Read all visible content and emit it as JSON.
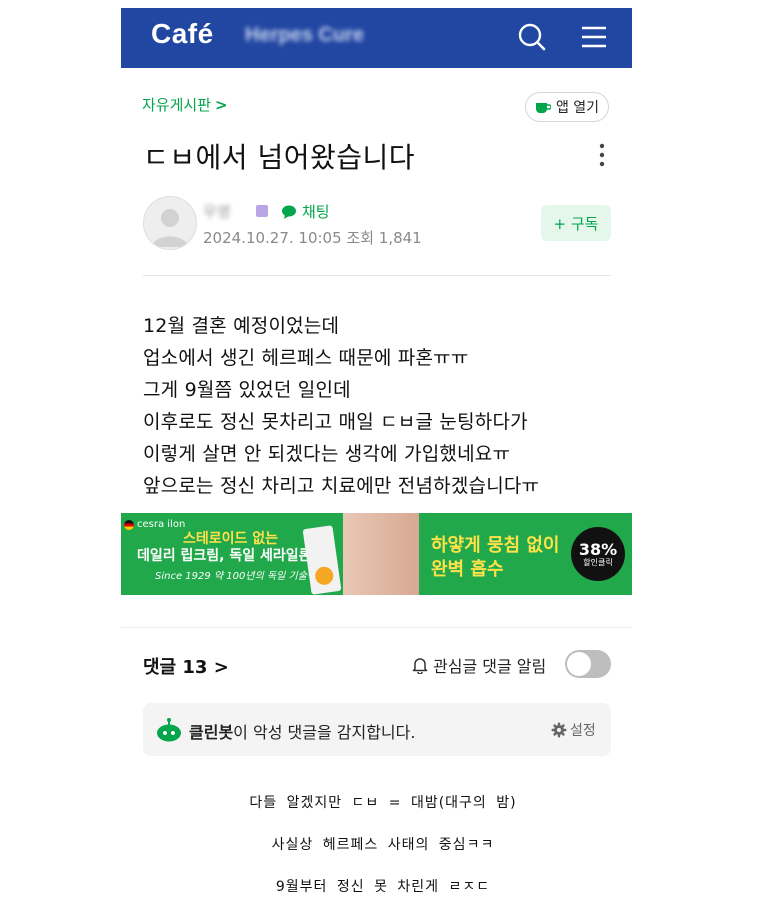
{
  "header": {
    "logo": "Café",
    "cafe_name": "Herpes Cure",
    "bg_color": "#2147a3"
  },
  "post": {
    "board": "자유게시판",
    "board_chevron": ">",
    "app_open": "앱 열기",
    "title": "ㄷㅂ에서 넘어왔습니다",
    "author": "우영",
    "chat": "채팅",
    "meta": "2024.10.27. 10:05  조회 1,841",
    "subscribe": "+ 구독",
    "body": [
      "12월 결혼 예정이었는데",
      "업소에서 생긴 헤르페스 때문에 파혼ㅠㅠ",
      "그게 9월쯤 있었던 일인데",
      "이후로도 정신 못차리고 매일 ㄷㅂ글 눈팅하다가",
      "이렇게 살면 안 되겠다는 생각에 가입했네요ㅠ",
      "앞으로는 정신 차리고 치료에만 전념하겠습니다ㅠ"
    ]
  },
  "ad": {
    "brand": "cesra ilon",
    "headline1": "스테로이드 없는",
    "headline2": "데일리 립크림, 독일 세라일론",
    "since": "Since 1929 약 100년의 독일 기술력",
    "right1": "하얗게 뭉침 없이",
    "right2": "완벽 흡수",
    "discount": "38%",
    "discount_sub": "할인클릭",
    "bg_color": "#21a84a"
  },
  "comments": {
    "label": "댓글 13 >",
    "alarm": "관심글 댓글 알림",
    "toggle_on": false
  },
  "cleanbot": {
    "name": "클린봇",
    "text": "이 악성 댓글을 감지합니다.",
    "settings": "설정"
  },
  "captions": [
    "다들 알겠지만 ㄷㅂ = 대밤(대구의 밤)",
    "사실상 헤르페스 사태의 중심ㅋㅋ",
    "9월부터 정신 못 차린게 ㄹㅈㄷ"
  ],
  "accent_color": "#05a54c"
}
